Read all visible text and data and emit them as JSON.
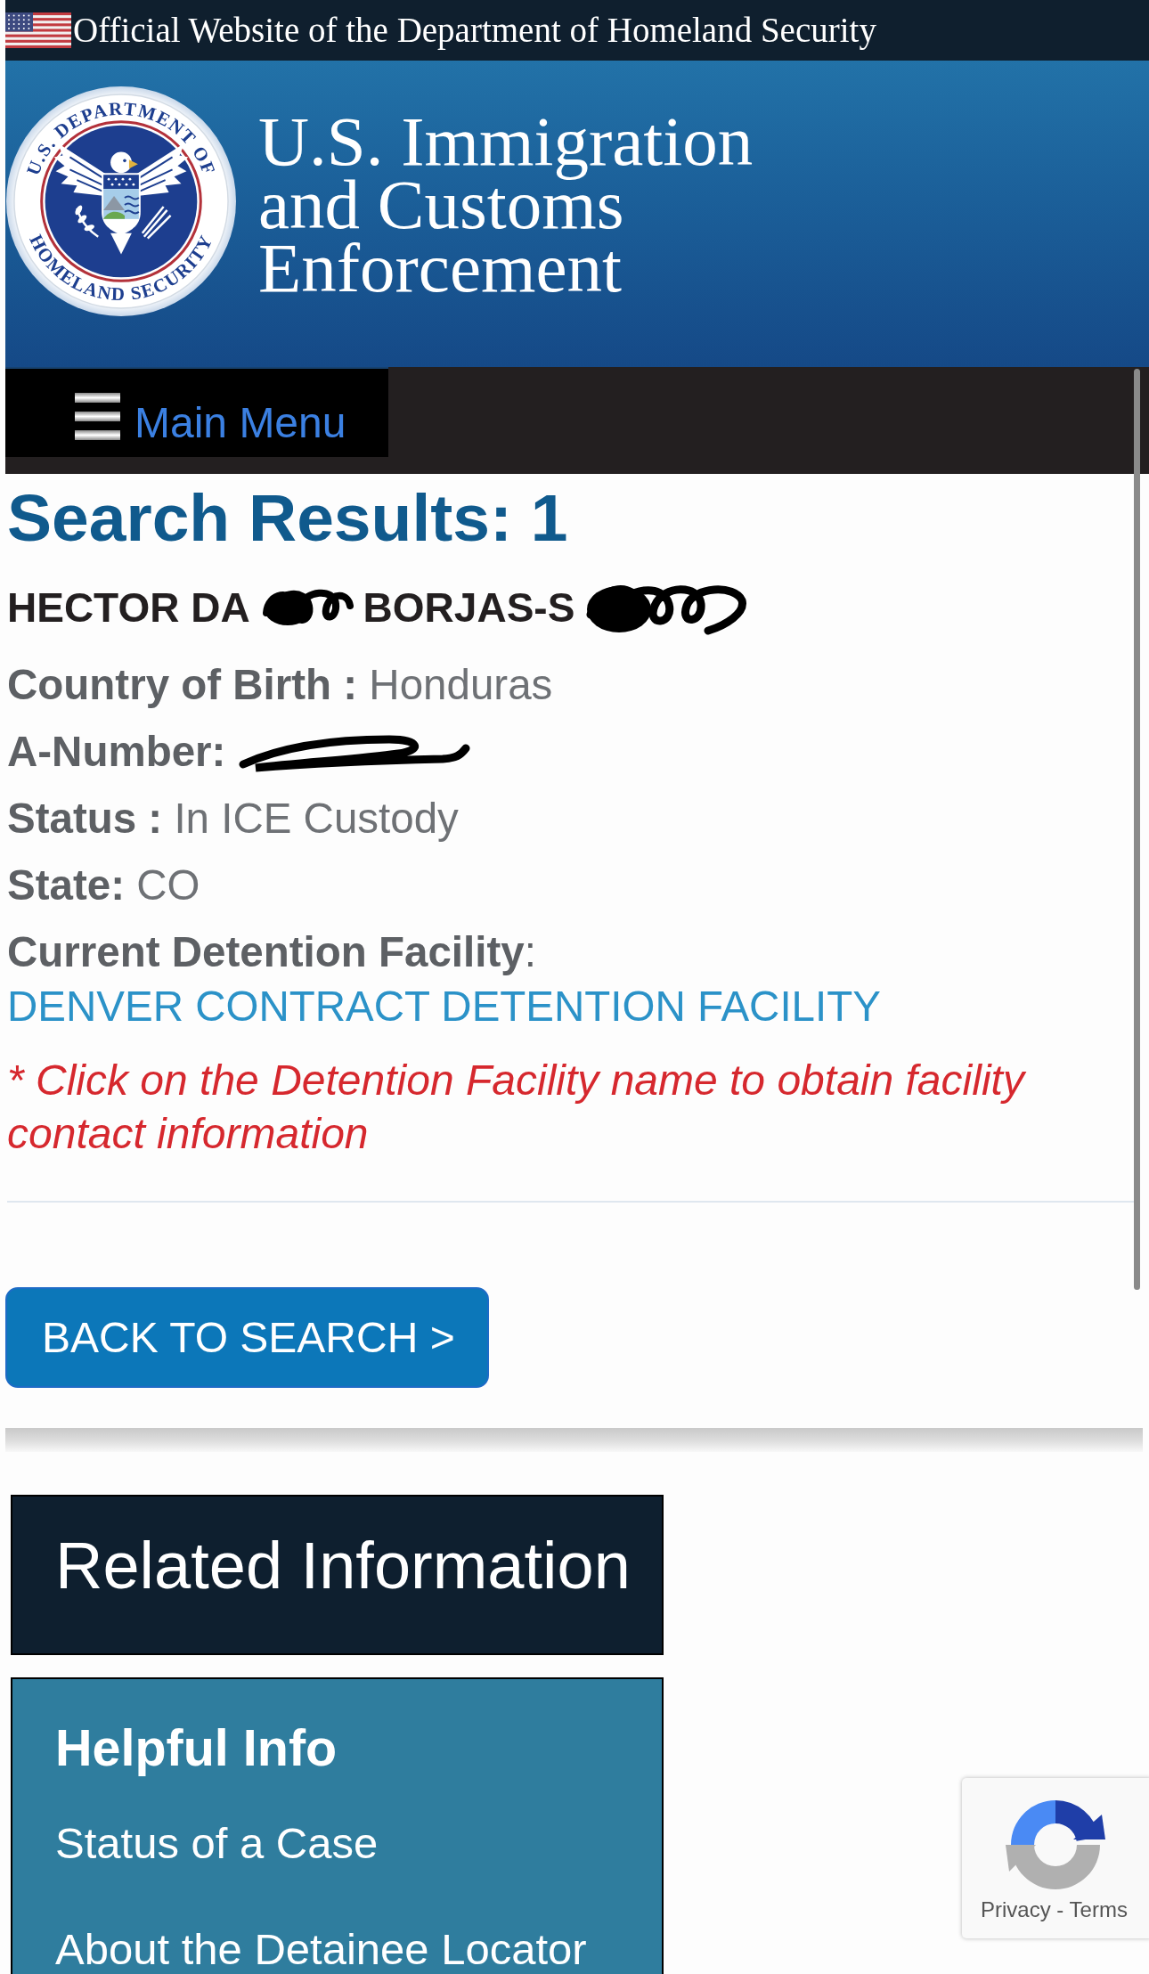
{
  "top_bar": {
    "text": "Official Website of the Department of Homeland Security"
  },
  "header": {
    "seal": {
      "top_text": "U.S. DEPARTMENT OF",
      "bottom_text": "HOMELAND SECURITY"
    },
    "title": "U.S. Immigration and Customs Enforcement"
  },
  "nav": {
    "menu_button": "Main Menu"
  },
  "results": {
    "heading": "Search Results: 1",
    "name": [
      {
        "kind": "text",
        "text": "HECTOR DA"
      },
      {
        "kind": "redaction"
      },
      {
        "kind": "text",
        "text": "BORJAS-S"
      },
      {
        "kind": "redaction"
      }
    ],
    "fields": [
      {
        "kind": "text",
        "label": "Country of Birth :",
        "value": "Honduras"
      },
      {
        "kind": "redacted",
        "label": "A-Number:"
      },
      {
        "kind": "text",
        "label": "Status :",
        "value": "In ICE Custody"
      },
      {
        "kind": "text",
        "label": "State:",
        "value": "CO"
      },
      {
        "kind": "link",
        "label": "**Current Detention Facility**:",
        "value": "DENVER CONTRACT DETENTION FACILITY"
      }
    ],
    "note": "* Click on the Detention Facility name to obtain facility contact information",
    "back_button": "BACK TO SEARCH >"
  },
  "related": {
    "title": "Related Information",
    "helpful_info": {
      "title": "Helpful Info",
      "links": [
        "Status of a Case",
        "About the Detainee Locator"
      ]
    }
  },
  "recaptcha": {
    "links": [
      "Privacy",
      "Terms"
    ],
    "separator": "-"
  }
}
